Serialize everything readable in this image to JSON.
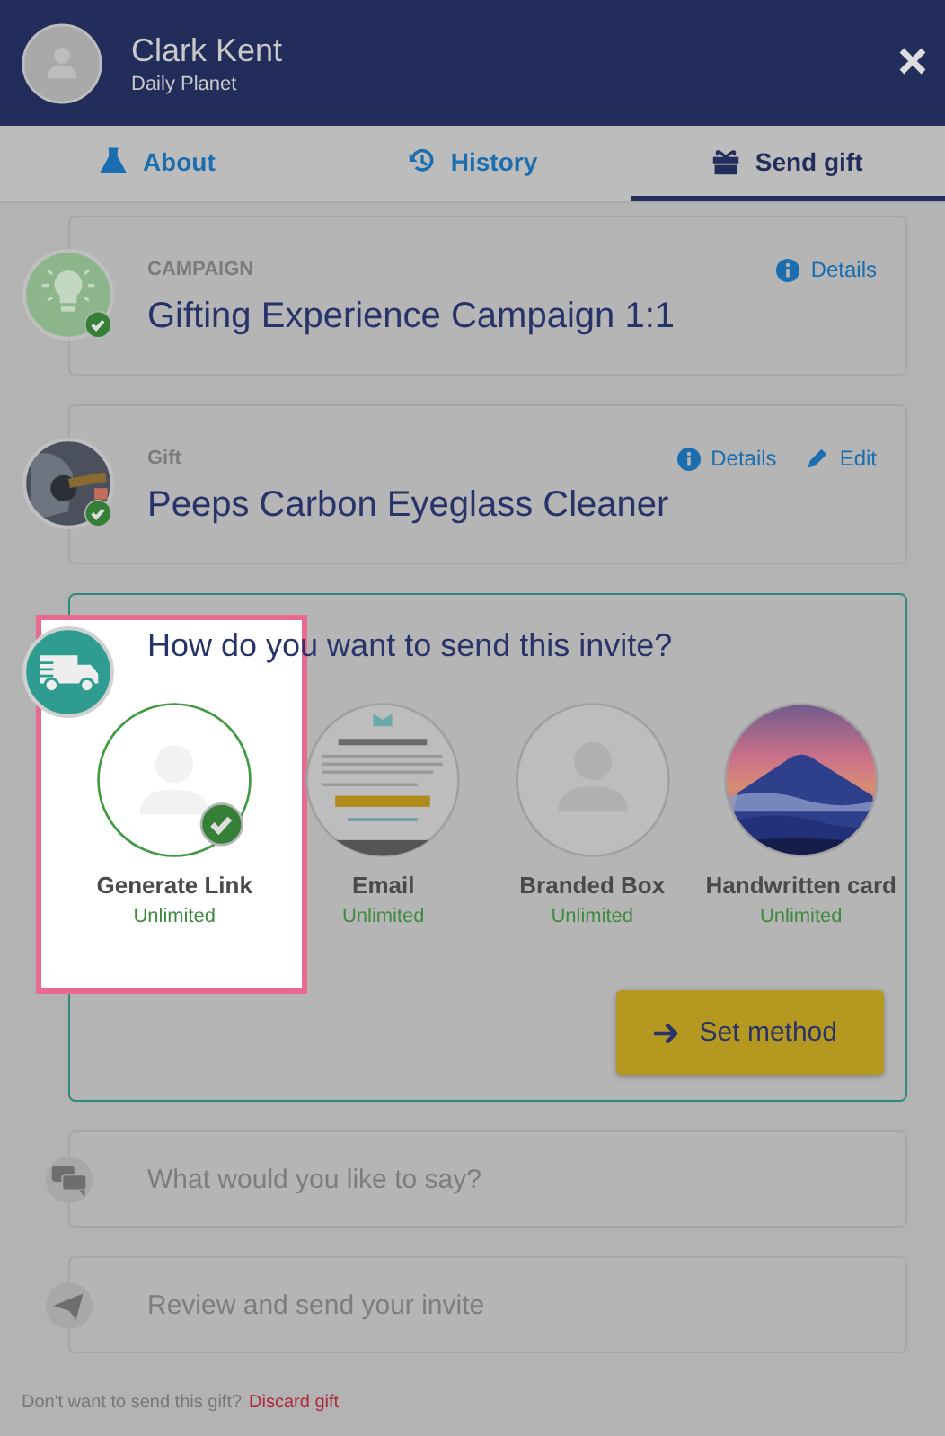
{
  "header": {
    "name": "Clark Kent",
    "company": "Daily Planet"
  },
  "tabs": [
    {
      "label": "About",
      "selected": false
    },
    {
      "label": "History",
      "selected": false
    },
    {
      "label": "Send gift",
      "selected": true
    }
  ],
  "steps": [
    {
      "kind": "summary",
      "label": "CAMPAIGN",
      "title": "Gifting Experience Campaign 1:1",
      "done": true,
      "actions": [
        {
          "kind": "info",
          "label": "Details"
        }
      ]
    },
    {
      "kind": "summary",
      "label": "Gift",
      "title": "Peeps Carbon Eyeglass Cleaner",
      "done": true,
      "actions": [
        {
          "kind": "info",
          "label": "Details"
        },
        {
          "kind": "edit",
          "label": "Edit"
        }
      ]
    },
    {
      "kind": "method",
      "question": "How do you want to send this invite?",
      "button": "Set method",
      "methods": [
        {
          "kind": "link",
          "name": "Generate Link",
          "note": "Unlimited",
          "selected": true,
          "highlighted": true
        },
        {
          "kind": "email",
          "name": "Email",
          "note": "Unlimited",
          "selected": false,
          "highlighted": false
        },
        {
          "kind": "box",
          "name": "Branded Box",
          "note": "Unlimited",
          "selected": false,
          "highlighted": false
        },
        {
          "kind": "card",
          "name": "Handwritten card",
          "note": "Unlimited",
          "selected": false,
          "highlighted": false
        }
      ]
    },
    {
      "kind": "pending",
      "title": "What would you like to say?"
    },
    {
      "kind": "pending",
      "title": "Review and send your invite"
    }
  ],
  "footer": {
    "question": "Don't want to send this gift?",
    "link": "Discard gift"
  }
}
